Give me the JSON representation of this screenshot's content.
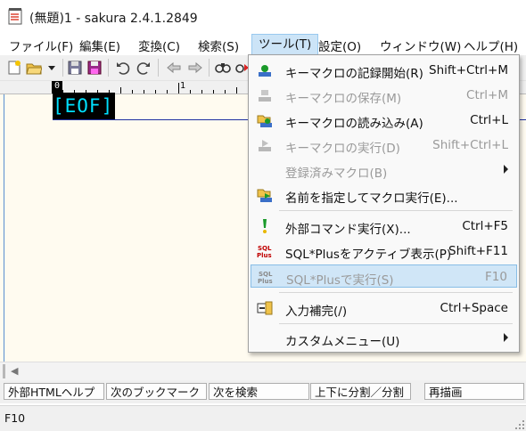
{
  "window": {
    "title": "(無題)1 - sakura 2.4.1.2849"
  },
  "menubar": [
    {
      "name": "menu-file",
      "label": "ファイル(F)"
    },
    {
      "name": "menu-edit",
      "label": "編集(E)"
    },
    {
      "name": "menu-convert",
      "label": "変換(C)"
    },
    {
      "name": "menu-search",
      "label": "検索(S)"
    },
    {
      "name": "menu-tools",
      "label": "ツール(T)"
    },
    {
      "name": "menu-settings",
      "label": "設定(O)"
    },
    {
      "name": "menu-window",
      "label": "ウィンドウ(W)"
    },
    {
      "name": "menu-help",
      "label": "ヘルプ(H)"
    }
  ],
  "ruler": {
    "cursor_col": "0",
    "mark": "1"
  },
  "editor": {
    "eof": "[EOF]"
  },
  "tools_menu": {
    "items": [
      {
        "label": "キーマクロの記録開始(R)",
        "shortcut": "Shift+Ctrl+M",
        "enabled": true,
        "icon": "record-macro-icon"
      },
      {
        "label": "キーマクロの保存(M)",
        "shortcut": "Ctrl+M",
        "enabled": false,
        "icon": "save-macro-icon"
      },
      {
        "label": "キーマクロの読み込み(A)",
        "shortcut": "Ctrl+L",
        "enabled": true,
        "icon": "load-macro-icon"
      },
      {
        "label": "キーマクロの実行(D)",
        "shortcut": "Shift+Ctrl+L",
        "enabled": false,
        "icon": "run-macro-icon"
      },
      {
        "label": "登録済みマクロ(B)",
        "shortcut": "",
        "enabled": false,
        "icon": "",
        "submenu": true
      },
      {
        "label": "名前を指定してマクロ実行(E)...",
        "shortcut": "",
        "enabled": true,
        "icon": "named-macro-icon"
      },
      {
        "label": "外部コマンド実行(X)...",
        "shortcut": "Ctrl+F5",
        "enabled": true,
        "icon": "external-command-icon"
      },
      {
        "label": "SQL*Plusをアクティブ表示(P)",
        "shortcut": "Shift+F11",
        "enabled": true,
        "icon": "sqlplus-activate-icon"
      },
      {
        "label": "SQL*Plusで実行(S)",
        "shortcut": "F10",
        "enabled": false,
        "icon": "sqlplus-run-icon",
        "highlighted": true
      },
      {
        "label": "入力補完(/)",
        "shortcut": "Ctrl+Space",
        "enabled": true,
        "icon": "autocomplete-icon"
      },
      {
        "label": "カスタムメニュー(U)",
        "shortcut": "",
        "enabled": true,
        "icon": "",
        "submenu": true
      }
    ]
  },
  "function_keys": [
    "外部HTMLヘルプ",
    "次のブックマーク",
    "次を検索",
    "上下に分割／分割",
    "再描画"
  ],
  "status": {
    "text": "F10"
  },
  "icon_sql": "SQL",
  "icon_plus": "Plus",
  "colors": {
    "accent": "#0078d7",
    "highlight": "#cce4f7",
    "eof_fg": "#00e0ff"
  }
}
